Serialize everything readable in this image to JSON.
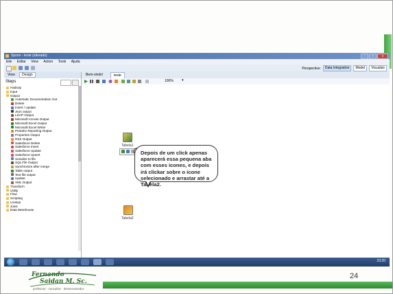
{
  "slide": {
    "page_number": "24",
    "logo_line1": "Fernando",
    "logo_line2": "Saidan M. Sc.",
    "logo_tagline": "professor · consultor · desenvolvedor"
  },
  "window": {
    "title": "Spoon - teste (alterado)",
    "buttons": [
      "–",
      "□",
      "x"
    ]
  },
  "menu": [
    "Eile",
    "Editar",
    "View",
    "Action",
    "Tools",
    "Ajuda"
  ],
  "perspective": {
    "label": "Perspective:",
    "items": [
      {
        "label": "Data Integration",
        "active": true
      },
      {
        "label": "Model",
        "active": false
      },
      {
        "label": "Visualize",
        "active": false
      }
    ]
  },
  "left_panel": {
    "tabs": [
      "View",
      "Design"
    ],
    "active_tab": "Design",
    "steps_title": "Steps",
    "tree": [
      {
        "label": "Hadoop",
        "level": 0,
        "icon": "folder-icon"
      },
      {
        "label": "Input",
        "level": 0,
        "icon": "folder-icon"
      },
      {
        "label": "Output",
        "level": 0,
        "icon": "folder-icon"
      },
      {
        "label": "Automatic Documentation Out",
        "level": 1,
        "icon": "doc-icon",
        "color": "#5a8f3a"
      },
      {
        "label": "Delete",
        "level": 1,
        "icon": "delete-icon",
        "color": "#c0392b"
      },
      {
        "label": "Insert / Update",
        "level": 1,
        "icon": "insert-update-icon",
        "color": "#4a7ab8"
      },
      {
        "label": "Json output",
        "level": 1,
        "icon": "json-icon",
        "color": "#333333"
      },
      {
        "label": "LDAP Output",
        "level": 1,
        "icon": "ldap-icon",
        "color": "#7a5a2a"
      },
      {
        "label": "Microsoft Access Output",
        "level": 1,
        "icon": "access-icon",
        "color": "#a8324a"
      },
      {
        "label": "Microsoft Excel Output",
        "level": 1,
        "icon": "excel-icon",
        "color": "#2e7d32"
      },
      {
        "label": "Microsoft Excel Writer",
        "level": 1,
        "icon": "excel-writer-icon",
        "color": "#2e7d32"
      },
      {
        "label": "Pentaho Reporting Output",
        "level": 1,
        "icon": "report-icon",
        "color": "#e08a1e"
      },
      {
        "label": "Properties Output",
        "level": 1,
        "icon": "properties-icon",
        "color": "#7f6fb0"
      },
      {
        "label": "RSS Output",
        "level": 1,
        "icon": "rss-icon",
        "color": "#f08a24"
      },
      {
        "label": "Salesforce Delete",
        "level": 1,
        "icon": "salesforce-icon",
        "color": "#d05050"
      },
      {
        "label": "Salesforce Insert",
        "level": 1,
        "icon": "salesforce-icon",
        "color": "#d05050"
      },
      {
        "label": "Salesforce Update",
        "level": 1,
        "icon": "salesforce-icon",
        "color": "#d05050"
      },
      {
        "label": "Salesforce Upsert",
        "level": 1,
        "icon": "salesforce-icon",
        "color": "#d05050"
      },
      {
        "label": "Serialize to file",
        "level": 1,
        "icon": "serialize-icon",
        "color": "#4a7ab8"
      },
      {
        "label": "SQL File Output",
        "level": 1,
        "icon": "sql-icon",
        "color": "#6a4a2a"
      },
      {
        "label": "Synchronize after merge",
        "level": 1,
        "icon": "sync-icon",
        "color": "#b8a030"
      },
      {
        "label": "Table output",
        "level": 1,
        "icon": "table-icon",
        "color": "#3a7a3a"
      },
      {
        "label": "Text file output",
        "level": 1,
        "icon": "text-file-icon",
        "color": "#666666"
      },
      {
        "label": "Update",
        "level": 1,
        "icon": "update-icon",
        "color": "#4a7ab8"
      },
      {
        "label": "XML Output",
        "level": 1,
        "icon": "xml-icon",
        "color": "#a05a2a"
      },
      {
        "label": "Transform",
        "level": 0,
        "icon": "folder-icon"
      },
      {
        "label": "Utility",
        "level": 0,
        "icon": "folder-icon"
      },
      {
        "label": "Flow",
        "level": 0,
        "icon": "folder-icon"
      },
      {
        "label": "Scripting",
        "level": 0,
        "icon": "folder-icon"
      },
      {
        "label": "Lookup",
        "level": 0,
        "icon": "folder-icon"
      },
      {
        "label": "Joins",
        "level": 0,
        "icon": "folder-icon"
      },
      {
        "label": "Data Warehouse",
        "level": 0,
        "icon": "folder-icon"
      }
    ]
  },
  "editor": {
    "tabs": [
      "Bem-vindo!",
      "teste"
    ],
    "active_tab": "teste",
    "zoom": "100%",
    "steps": [
      {
        "label": "Tabela1",
        "icon": "table-input-icon"
      },
      {
        "label": "Tabela2",
        "icon": "table-output-icon"
      }
    ]
  },
  "callout": {
    "text": "Depois de um click apenas aparecerá essa pequena aba com esses icones, e depois irá clickar sobre o icone selecionado e arrastar até a Tabela2."
  },
  "taskbar": {
    "clock": "23:20"
  },
  "colors": {
    "accent_green": "#3ca63c",
    "titlebar_blue": "#4a6ea8"
  }
}
